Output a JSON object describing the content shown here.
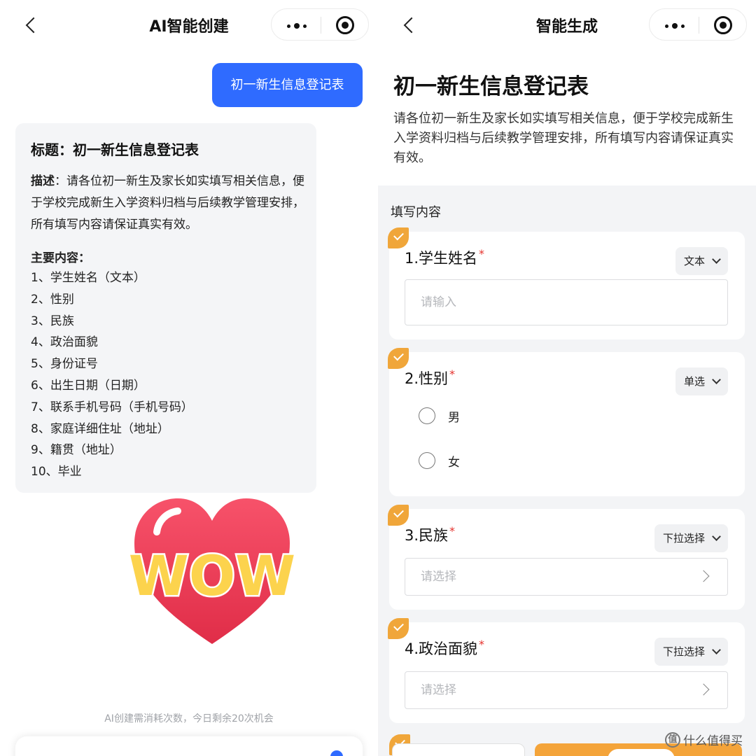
{
  "left": {
    "nav_title": "AI智能创建",
    "user_message": "初一新生信息登记表",
    "ai_reply": {
      "title": "标题：初一新生信息登记表",
      "desc_label": "描述",
      "desc_text": "：请各位初一新生及家长如实填写相关信息，便于学校完成新生入学资料归档与后续教学管理安排，所有填写内容请保证真实有效。",
      "main_label": "主要内容：",
      "items": [
        "1、学生姓名（文本）",
        "2、性别",
        "3、民族",
        "4、政治面貌",
        "5、身份证号",
        "6、出生日期（日期）",
        "7、联系手机号码（手机号码）",
        "8、家庭详细住址（地址）",
        "9、籍贯（地址）",
        "10、毕业"
      ]
    },
    "sticker_text": "WOW",
    "footer_hint": "AI创建需消耗次数，今日剩余20次机会"
  },
  "right": {
    "nav_title": "智能生成",
    "form_title": "初一新生信息登记表",
    "form_desc": "请各位初一新生及家长如实填写相关信息，便于学校完成新生入学资料归档与后续教学管理安排，所有填写内容请保证真实有效。",
    "section_label": "填写内容",
    "questions": [
      {
        "title": "1.学生姓名",
        "type": "文本",
        "placeholder": "请输入"
      },
      {
        "title": "2.性别",
        "type": "单选",
        "options": [
          "男",
          "女"
        ]
      },
      {
        "title": "3.民族",
        "type": "下拉选择",
        "placeholder": "请选择"
      },
      {
        "title": "4.政治面貌",
        "type": "下拉选择",
        "placeholder": "请选择"
      }
    ],
    "required_mark": "*"
  },
  "watermark": {
    "icon": "值",
    "text": "什么值得买"
  },
  "colors": {
    "primary_blue": "#2f6bff",
    "accent_orange": "#f0a63a",
    "required_red": "#e5322d",
    "form_bg": "#f3f4f6"
  }
}
